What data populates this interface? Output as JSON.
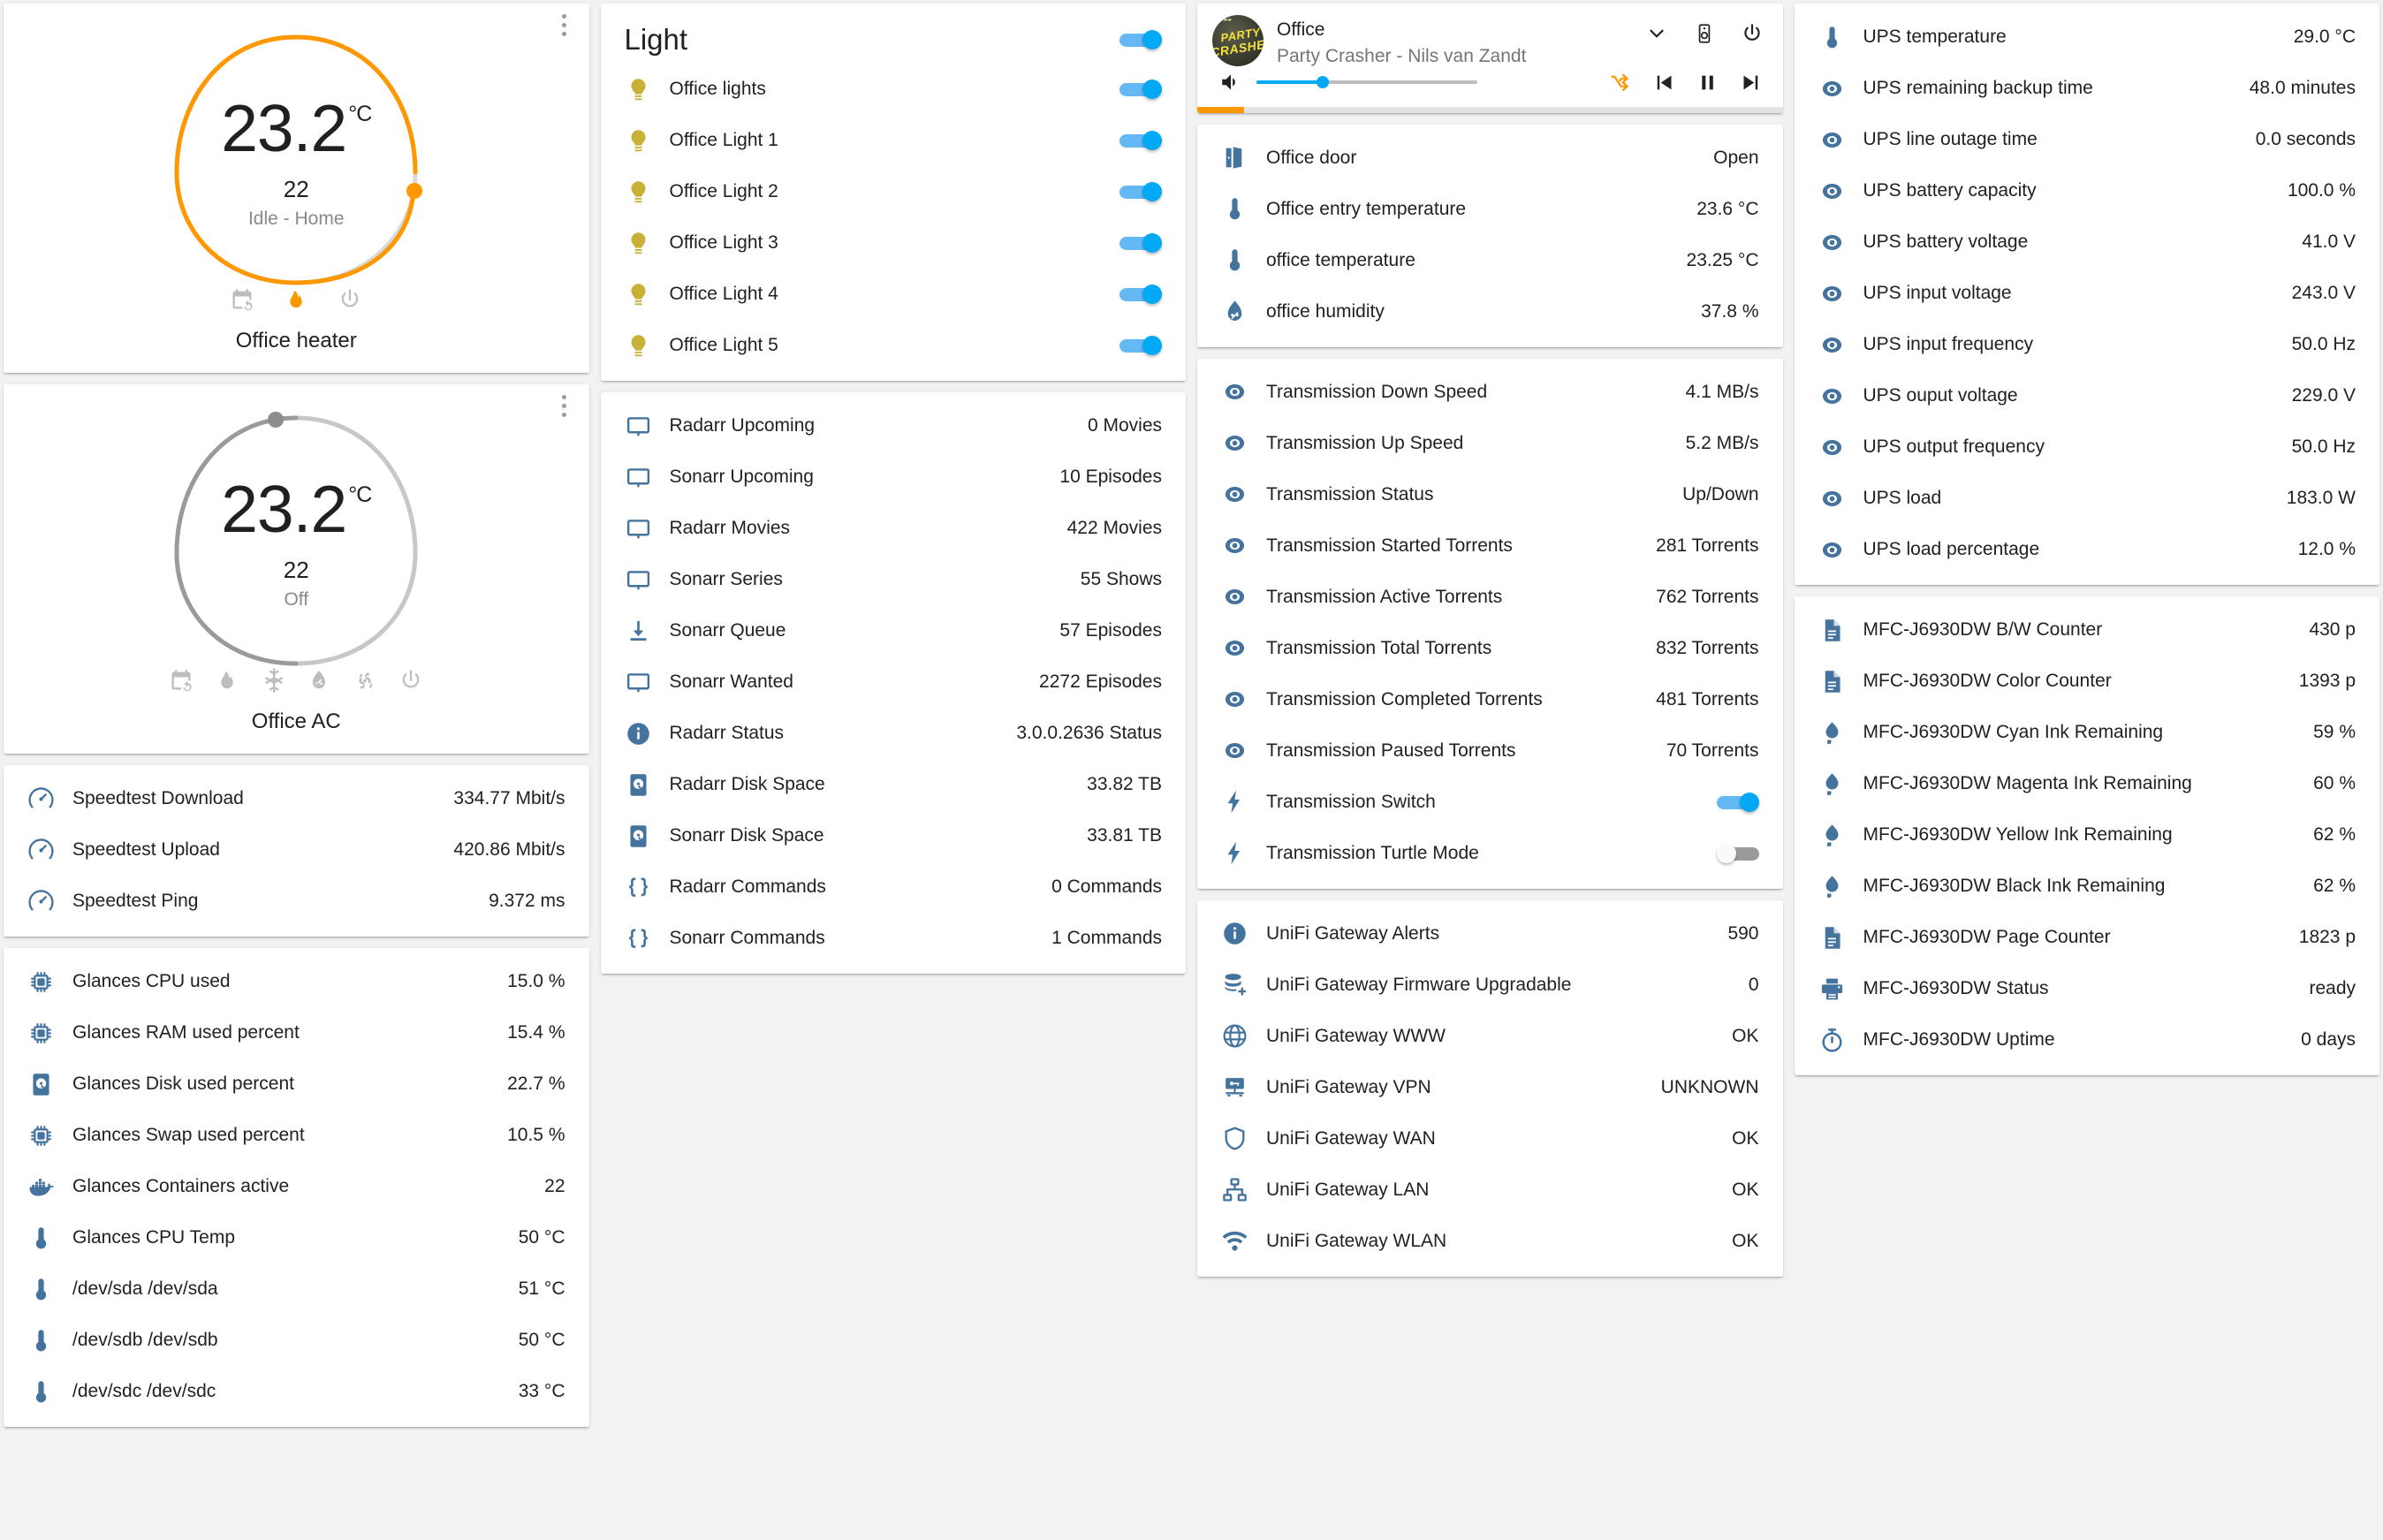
{
  "colors": {
    "accent_blue": "#03a9f4",
    "icon_blue": "#44739e",
    "heat_orange": "#ff9800",
    "bulb_yellow": "#c9b037",
    "inactive_gray": "#9a9a9a"
  },
  "thermostats": [
    {
      "name": "Office heater",
      "current_temp": "23.2",
      "unit": "°C",
      "target_temp": "22",
      "state": "Idle - Home",
      "active": true,
      "modes": [
        "schedule-icon",
        "flame-icon",
        "power-icon"
      ],
      "active_mode": "flame-icon"
    },
    {
      "name": "Office AC",
      "current_temp": "23.2",
      "unit": "°C",
      "target_temp": "22",
      "state": "Off",
      "active": false,
      "modes": [
        "schedule-icon",
        "flame-icon",
        "snowflake-icon",
        "humidity-icon",
        "fan-icon",
        "power-icon"
      ],
      "active_mode": ""
    }
  ],
  "speedtest": {
    "rows": [
      {
        "icon": "speedometer-icon",
        "name": "Speedtest Download",
        "value": "334.77 Mbit/s"
      },
      {
        "icon": "speedometer-icon",
        "name": "Speedtest Upload",
        "value": "420.86 Mbit/s"
      },
      {
        "icon": "speedometer-icon",
        "name": "Speedtest Ping",
        "value": "9.372 ms"
      }
    ]
  },
  "glances": {
    "rows": [
      {
        "icon": "chip-icon",
        "name": "Glances CPU used",
        "value": "15.0 %"
      },
      {
        "icon": "chip-icon",
        "name": "Glances RAM used percent",
        "value": "15.4 %"
      },
      {
        "icon": "harddisk-icon",
        "name": "Glances Disk used percent",
        "value": "22.7 %"
      },
      {
        "icon": "chip-icon",
        "name": "Glances Swap used percent",
        "value": "10.5 %"
      },
      {
        "icon": "docker-icon",
        "name": "Glances Containers active",
        "value": "22"
      },
      {
        "icon": "thermometer-icon",
        "name": "Glances CPU Temp",
        "value": "50 °C"
      },
      {
        "icon": "thermometer-icon",
        "name": "/dev/sda /dev/sda",
        "value": "51 °C"
      },
      {
        "icon": "thermometer-icon",
        "name": "/dev/sdb /dev/sdb",
        "value": "50 °C"
      },
      {
        "icon": "thermometer-icon",
        "name": "/dev/sdc /dev/sdc",
        "value": "33 °C"
      }
    ]
  },
  "light_card": {
    "title": "Light",
    "master_on": true,
    "lights": [
      {
        "icon": "lightbulb-icon",
        "name": "Office lights",
        "on": true
      },
      {
        "icon": "lightbulb-icon",
        "name": "Office Light 1",
        "on": true
      },
      {
        "icon": "lightbulb-icon",
        "name": "Office Light 2",
        "on": true
      },
      {
        "icon": "lightbulb-icon",
        "name": "Office Light 3",
        "on": true
      },
      {
        "icon": "lightbulb-icon",
        "name": "Office Light 4",
        "on": true
      },
      {
        "icon": "lightbulb-icon",
        "name": "Office Light 5",
        "on": true
      }
    ]
  },
  "media_card": {
    "rows": [
      {
        "icon": "monitor-icon",
        "name": "Radarr Upcoming",
        "value": "0 Movies"
      },
      {
        "icon": "monitor-icon",
        "name": "Sonarr Upcoming",
        "value": "10 Episodes"
      },
      {
        "icon": "monitor-icon",
        "name": "Radarr Movies",
        "value": "422 Movies"
      },
      {
        "icon": "monitor-icon",
        "name": "Sonarr Series",
        "value": "55 Shows"
      },
      {
        "icon": "download-icon",
        "name": "Sonarr Queue",
        "value": "57 Episodes"
      },
      {
        "icon": "monitor-icon",
        "name": "Sonarr Wanted",
        "value": "2272 Episodes"
      },
      {
        "icon": "info-icon",
        "name": "Radarr Status",
        "value": "3.0.0.2636 Status"
      },
      {
        "icon": "harddisk-icon",
        "name": "Radarr Disk Space",
        "value": "33.82 TB"
      },
      {
        "icon": "harddisk-icon",
        "name": "Sonarr Disk Space",
        "value": "33.81 TB"
      },
      {
        "icon": "braces-icon",
        "name": "Radarr Commands",
        "value": "0 Commands"
      },
      {
        "icon": "braces-icon",
        "name": "Sonarr Commands",
        "value": "1 Commands"
      }
    ]
  },
  "player": {
    "source": "Office",
    "now_playing": "Party Crasher - Nils van Zandt",
    "album_art_line1": "PARTY",
    "album_art_line2": "CRASHER",
    "volume_percent": 30,
    "progress_percent": 8,
    "buttons": [
      "chevron-down-icon",
      "speaker-icon",
      "power-icon"
    ],
    "controls": [
      "shuffle-icon",
      "previous-icon",
      "pause-icon",
      "next-icon"
    ],
    "volume_icon": "volume-high-icon"
  },
  "office_card": {
    "rows": [
      {
        "icon": "door-open-icon",
        "name": "Office door",
        "value": "Open"
      },
      {
        "icon": "thermometer-icon",
        "name": "Office entry temperature",
        "value": "23.6 °C"
      },
      {
        "icon": "thermometer-icon",
        "name": "office temperature",
        "value": "23.25 °C"
      },
      {
        "icon": "humidity-icon",
        "name": "office humidity",
        "value": "37.8 %"
      }
    ]
  },
  "transmission_card": {
    "rows": [
      {
        "icon": "eye-icon",
        "name": "Transmission Down Speed",
        "value": "4.1 MB/s",
        "type": "sensor"
      },
      {
        "icon": "eye-icon",
        "name": "Transmission Up Speed",
        "value": "5.2 MB/s",
        "type": "sensor"
      },
      {
        "icon": "eye-icon",
        "name": "Transmission Status",
        "value": "Up/Down",
        "type": "sensor"
      },
      {
        "icon": "eye-icon",
        "name": "Transmission Started Torrents",
        "value": "281 Torrents",
        "type": "sensor"
      },
      {
        "icon": "eye-icon",
        "name": "Transmission Active Torrents",
        "value": "762 Torrents",
        "type": "sensor"
      },
      {
        "icon": "eye-icon",
        "name": "Transmission Total Torrents",
        "value": "832 Torrents",
        "type": "sensor"
      },
      {
        "icon": "eye-icon",
        "name": "Transmission Completed Torrents",
        "value": "481 Torrents",
        "type": "sensor"
      },
      {
        "icon": "eye-icon",
        "name": "Transmission Paused Torrents",
        "value": "70 Torrents",
        "type": "sensor"
      },
      {
        "icon": "flash-icon",
        "name": "Transmission Switch",
        "value": "",
        "type": "switch",
        "on": true
      },
      {
        "icon": "flash-icon",
        "name": "Transmission Turtle Mode",
        "value": "",
        "type": "switch",
        "on": false
      }
    ]
  },
  "unifi_card": {
    "rows": [
      {
        "icon": "info-icon",
        "name": "UniFi Gateway Alerts",
        "value": "590"
      },
      {
        "icon": "database-plus-icon",
        "name": "UniFi Gateway Firmware Upgradable",
        "value": "0"
      },
      {
        "icon": "globe-icon",
        "name": "UniFi Gateway WWW",
        "value": "OK"
      },
      {
        "icon": "vpn-icon",
        "name": "UniFi Gateway VPN",
        "value": "UNKNOWN"
      },
      {
        "icon": "shield-icon",
        "name": "UniFi Gateway WAN",
        "value": "OK"
      },
      {
        "icon": "lan-icon",
        "name": "UniFi Gateway LAN",
        "value": "OK"
      },
      {
        "icon": "wifi-icon",
        "name": "UniFi Gateway WLAN",
        "value": "OK"
      }
    ]
  },
  "ups_card": {
    "rows": [
      {
        "icon": "thermometer-icon",
        "name": "UPS temperature",
        "value": "29.0 °C"
      },
      {
        "icon": "eye-icon",
        "name": "UPS remaining backup time",
        "value": "48.0 minutes"
      },
      {
        "icon": "eye-icon",
        "name": "UPS line outage time",
        "value": "0.0 seconds"
      },
      {
        "icon": "eye-icon",
        "name": "UPS battery capacity",
        "value": "100.0 %"
      },
      {
        "icon": "eye-icon",
        "name": "UPS battery voltage",
        "value": "41.0 V"
      },
      {
        "icon": "eye-icon",
        "name": "UPS input voltage",
        "value": "243.0 V"
      },
      {
        "icon": "eye-icon",
        "name": "UPS input frequency",
        "value": "50.0 Hz"
      },
      {
        "icon": "eye-icon",
        "name": "UPS ouput voltage",
        "value": "229.0 V"
      },
      {
        "icon": "eye-icon",
        "name": "UPS output frequency",
        "value": "50.0 Hz"
      },
      {
        "icon": "eye-icon",
        "name": "UPS load",
        "value": "183.0 W"
      },
      {
        "icon": "eye-icon",
        "name": "UPS load percentage",
        "value": "12.0 %"
      }
    ]
  },
  "printer_card": {
    "rows": [
      {
        "icon": "file-document-icon",
        "name": "MFC-J6930DW B/W Counter",
        "value": "430 p"
      },
      {
        "icon": "file-document-icon",
        "name": "MFC-J6930DW Color Counter",
        "value": "1393 p"
      },
      {
        "icon": "water-icon",
        "name": "MFC-J6930DW Cyan Ink Remaining",
        "value": "59 %"
      },
      {
        "icon": "water-icon",
        "name": "MFC-J6930DW Magenta Ink Remaining",
        "value": "60 %"
      },
      {
        "icon": "water-icon",
        "name": "MFC-J6930DW Yellow Ink Remaining",
        "value": "62 %"
      },
      {
        "icon": "water-icon",
        "name": "MFC-J6930DW Black Ink Remaining",
        "value": "62 %"
      },
      {
        "icon": "file-document-icon",
        "name": "MFC-J6930DW Page Counter",
        "value": "1823 p"
      },
      {
        "icon": "printer-icon",
        "name": "MFC-J6930DW Status",
        "value": "ready"
      },
      {
        "icon": "timer-icon",
        "name": "MFC-J6930DW Uptime",
        "value": "0 days"
      }
    ]
  }
}
